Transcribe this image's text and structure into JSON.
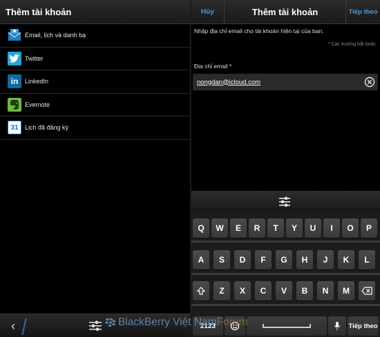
{
  "left_panel": {
    "title": "Thêm tài khoản",
    "accounts": [
      {
        "label": "Email, lịch và danh bạ",
        "icon": "email-calendar-contacts-icon",
        "color": "#1f7ec2"
      },
      {
        "label": "Twitter",
        "icon": "twitter-bird-icon",
        "color": "#1ea8d8"
      },
      {
        "label": "LinkedIn",
        "icon": "linkedin-icon",
        "color": "#0a6aa8"
      },
      {
        "label": "Evernote",
        "icon": "evernote-elephant-icon",
        "color": "#6cbb3c"
      },
      {
        "label": "Lịch đã đăng ký",
        "icon": "calendar-icon",
        "color": "#1a73b5",
        "icon_text": "31"
      }
    ],
    "footer": {
      "back_icon": "back-arrow-icon",
      "settings_icon": "settings-sliders-icon"
    }
  },
  "right_panel": {
    "cancel_label": "Hủy",
    "title": "Thêm tài khoản",
    "next_label": "Tiếp theo",
    "instruction": "Nhập địa chỉ email cho tài khoản hiện tại của bạn.",
    "required_note": "* Các trường bắt buộc",
    "email_label": "Địa chỉ email *",
    "email_value": "nongdan@icloud.com",
    "clear_icon": "clear-x-icon"
  },
  "keyboard": {
    "row1": [
      "Q",
      "W",
      "E",
      "R",
      "T",
      "Y",
      "U",
      "I",
      "O",
      "P"
    ],
    "row2": [
      "A",
      "S",
      "D",
      "F",
      "G",
      "H",
      "J",
      "K",
      "L"
    ],
    "row3": [
      "Z",
      "X",
      "C",
      "V",
      "B",
      "N",
      "M"
    ],
    "shift_icon": "shift-arrow-icon",
    "backspace_icon": "backspace-icon",
    "symbol_key": "2123",
    "emoji_icon": "emoticon-icon",
    "mic_icon": "microphone-icon",
    "enter_label": "Tiếp theo"
  },
  "watermark": {
    "brand": "BlackBerry Việt Nam",
    "suffix": "Forum"
  },
  "colors": {
    "accent": "#3c9de6",
    "background": "#000000",
    "key": "#454545"
  }
}
